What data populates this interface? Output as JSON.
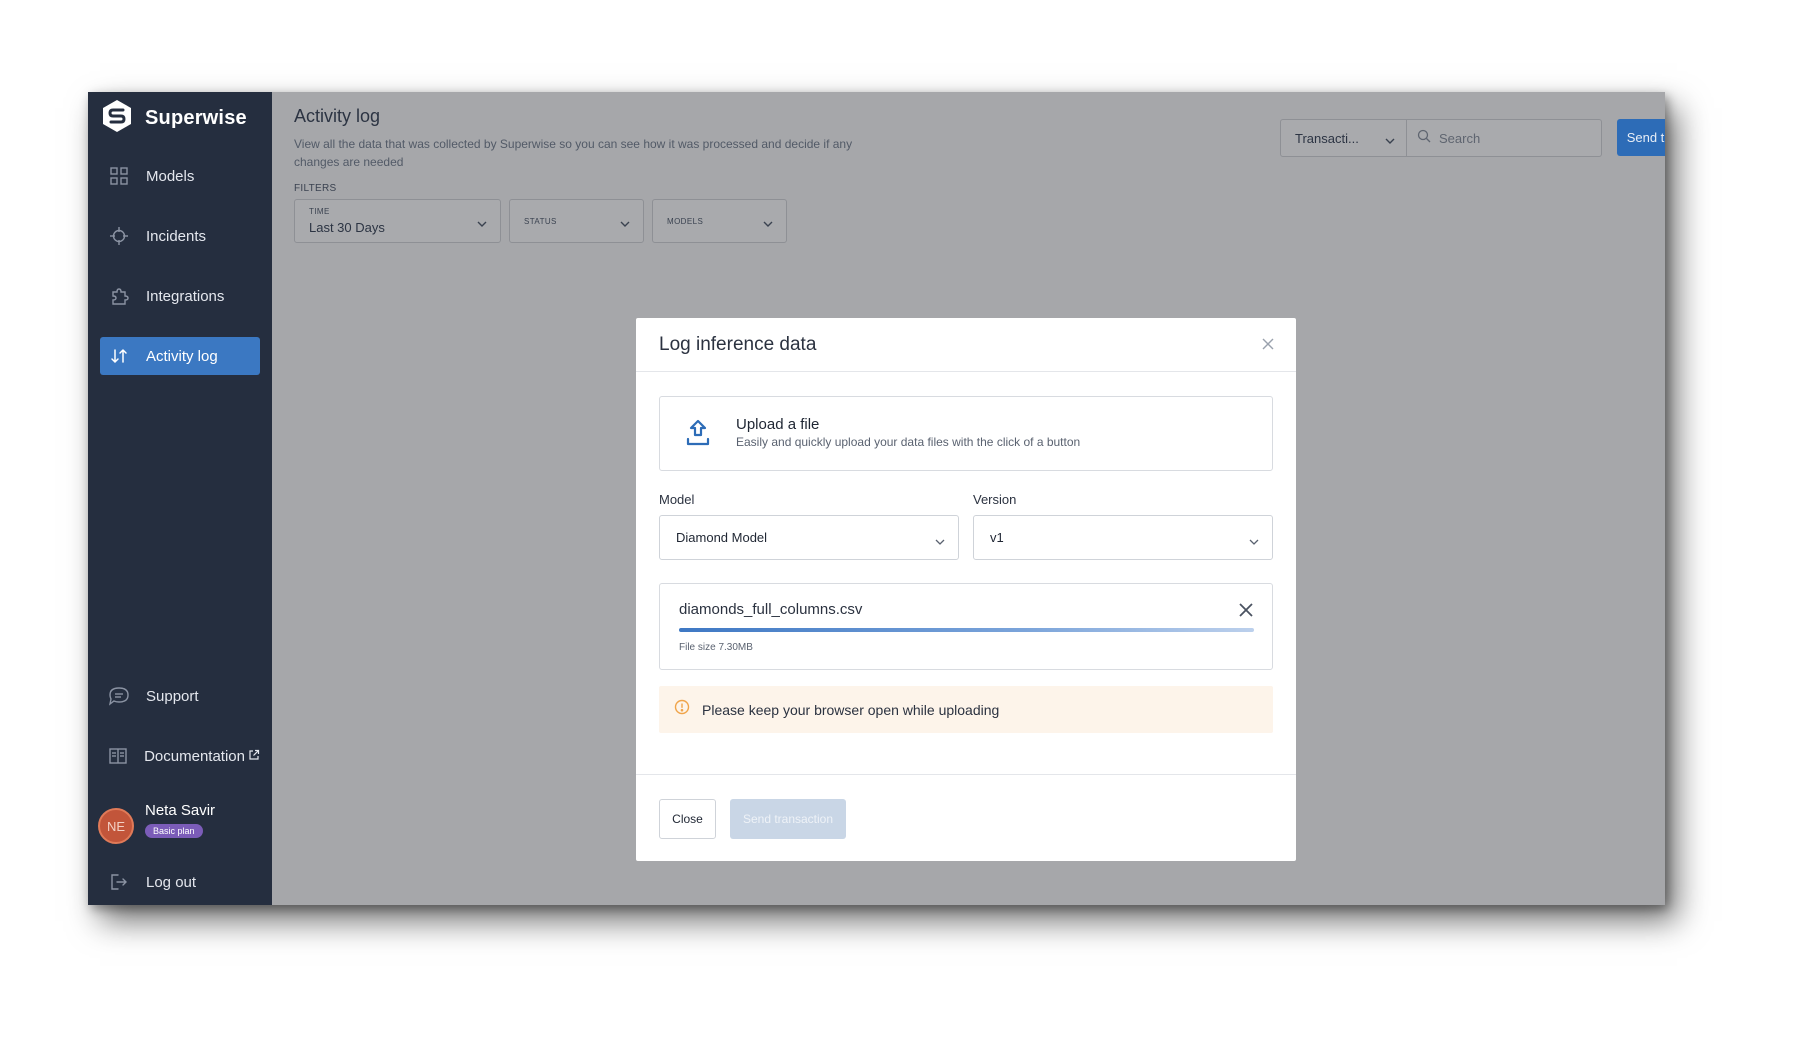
{
  "app": {
    "brand_name": "Superwise"
  },
  "sidebar": {
    "items": [
      {
        "label": "Models",
        "icon": "grid-icon"
      },
      {
        "label": "Incidents",
        "icon": "crosshair-icon"
      },
      {
        "label": "Integrations",
        "icon": "puzzle-icon"
      },
      {
        "label": "Activity log",
        "icon": "swap-arrows-icon",
        "active": true
      }
    ],
    "bottom_items": [
      {
        "label": "Support",
        "icon": "chat-icon"
      },
      {
        "label": "Documentation",
        "icon": "book-icon",
        "external": true
      }
    ],
    "user": {
      "initials": "NE",
      "name": "Neta Savir",
      "plan": "Basic plan"
    },
    "logout_label": "Log out"
  },
  "header": {
    "title": "Activity log",
    "description": "View all the data that was collected by Superwise so you can see how it was processed and decide if any changes are needed",
    "filters_label": "FILTERS",
    "filters": [
      {
        "caption": "TIME",
        "value": "Last 30 Days"
      },
      {
        "caption": "STATUS",
        "value": ""
      },
      {
        "caption": "MODELS",
        "value": ""
      }
    ],
    "type_select": "Transacti...",
    "search_placeholder": "Search",
    "send_button": "Send transaction"
  },
  "modal": {
    "title": "Log inference data",
    "upload": {
      "title": "Upload a file",
      "subtitle": "Easily and quickly upload your data files with the click of a button"
    },
    "model_label": "Model",
    "model_value": "Diamond Model",
    "version_label": "Version",
    "version_value": "v1",
    "file": {
      "name": "diamonds_full_columns.csv",
      "size": "File size 7.30MB",
      "progress": 1.0
    },
    "warning": "Please keep your browser open while uploading",
    "close_button": "Close",
    "send_button": "Send transaction"
  },
  "colors": {
    "sidebar_bg": "#252e3f",
    "accent": "#3b78c2",
    "overlay": "#a6a7aa",
    "warning_bg": "#fdf4ea",
    "warning_icon": "#f0a44a",
    "avatar": "#c2553a",
    "plan_badge": "#7b5cb8"
  }
}
